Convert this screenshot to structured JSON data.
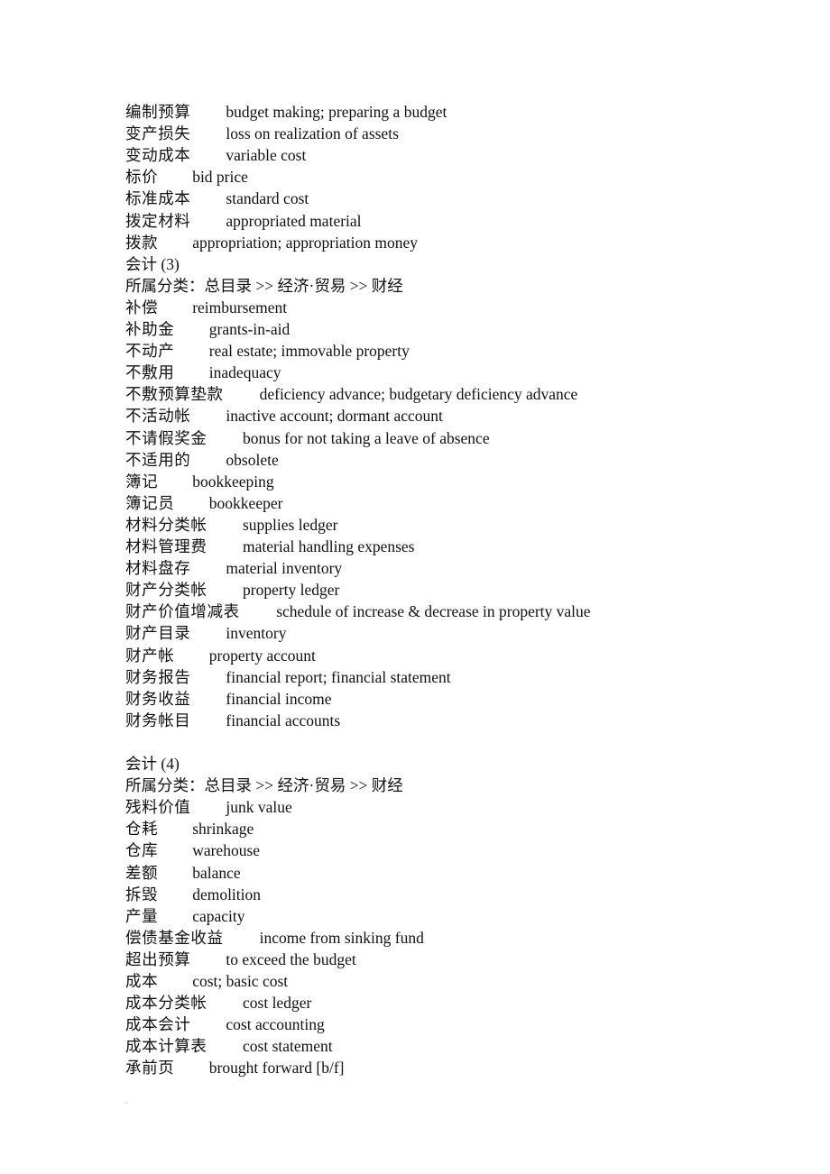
{
  "document": {
    "sections": [
      {
        "entries": [
          {
            "zh": "编制预算",
            "en": "budget making; preparing a budget"
          },
          {
            "zh": "变产损失",
            "en": "loss on realization of assets"
          },
          {
            "zh": "变动成本",
            "en": "variable cost"
          },
          {
            "zh": "标价",
            "en": "bid price"
          },
          {
            "zh": "标准成本",
            "en": "standard cost"
          },
          {
            "zh": "拨定材料",
            "en": "appropriated material"
          },
          {
            "zh": "拨款",
            "en": "appropriation; appropriation money"
          }
        ]
      },
      {
        "title": "会计 (3)",
        "category": "所属分类：总目录 >> 经济·贸易 >> 财经",
        "entries": [
          {
            "zh": "补偿",
            "en": "reimbursement"
          },
          {
            "zh": "补助金",
            "en": "grants-in-aid"
          },
          {
            "zh": "不动产",
            "en": "real estate; immovable property"
          },
          {
            "zh": "不敷用",
            "en": "inadequacy"
          },
          {
            "zh": "不敷预算垫款",
            "en": "deficiency advance; budgetary deficiency advance"
          },
          {
            "zh": "不活动帐",
            "en": "inactive account; dormant account"
          },
          {
            "zh": "不请假奖金",
            "en": "bonus for not taking a leave of absence"
          },
          {
            "zh": "不适用的",
            "en": "obsolete"
          },
          {
            "zh": "簿记",
            "en": "bookkeeping"
          },
          {
            "zh": "簿记员",
            "en": "bookkeeper"
          },
          {
            "zh": "材料分类帐",
            "en": "supplies ledger"
          },
          {
            "zh": "材料管理费",
            "en": "material handling expenses"
          },
          {
            "zh": "材料盘存",
            "en": "material inventory"
          },
          {
            "zh": "财产分类帐",
            "en": "property ledger"
          },
          {
            "zh": "财产价值增减表",
            "en": "schedule of increase & decrease in property value"
          },
          {
            "zh": "财产目录",
            "en": "inventory"
          },
          {
            "zh": "财产帐",
            "en": "property account"
          },
          {
            "zh": "财务报告",
            "en": "financial report; financial statement"
          },
          {
            "zh": "财务收益",
            "en": "financial income"
          },
          {
            "zh": "财务帐目",
            "en": "financial accounts"
          }
        ]
      },
      {
        "title": "会计 (4)",
        "category": "所属分类：总目录 >> 经济·贸易 >> 财经",
        "entries": [
          {
            "zh": "残料价值",
            "en": "junk value"
          },
          {
            "zh": "仓耗",
            "en": "shrinkage"
          },
          {
            "zh": "仓库",
            "en": "warehouse"
          },
          {
            "zh": "差额",
            "en": "balance"
          },
          {
            "zh": "拆毁",
            "en": "demolition"
          },
          {
            "zh": "产量",
            "en": "capacity"
          },
          {
            "zh": "偿债基金收益",
            "en": "income from sinking fund"
          },
          {
            "zh": "超出预算",
            "en": "to exceed the budget"
          },
          {
            "zh": "成本",
            "en": "cost; basic cost"
          },
          {
            "zh": "成本分类帐",
            "en": "cost ledger"
          },
          {
            "zh": "成本会计",
            "en": "cost accounting"
          },
          {
            "zh": "成本计算表",
            "en": "cost statement"
          },
          {
            "zh": "承前页",
            "en": "brought forward [b/f]"
          }
        ]
      }
    ]
  }
}
